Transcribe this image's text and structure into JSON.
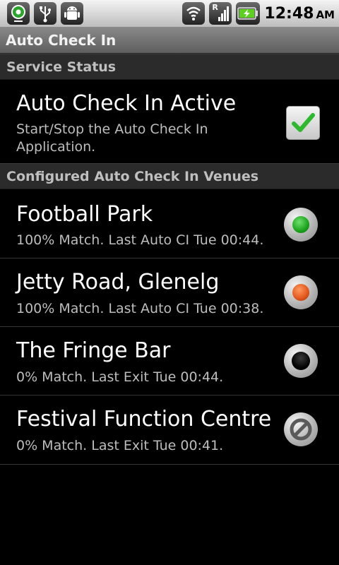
{
  "status_bar": {
    "left_icons": [
      "map-pin-icon",
      "usb-icon",
      "android-debug-icon"
    ],
    "right_icons": [
      "wifi-icon",
      "signal-icon",
      "battery-charging-icon"
    ],
    "signal_label": "R",
    "time": "12:48",
    "ampm": "AM"
  },
  "app": {
    "title": "Auto Check In"
  },
  "sections": {
    "service_status": "Service Status",
    "venues": "Configured Auto Check In Venues"
  },
  "service": {
    "title": "Auto Check In Active",
    "summary_line1": "Start/Stop the Auto Check In",
    "summary_line2": "Application.",
    "checked": true
  },
  "venues": [
    {
      "name": "Football Park",
      "summary": "100% Match. Last Auto CI Tue 00:44.",
      "status": "green",
      "color": "#1aa31a"
    },
    {
      "name": "Jetty Road, Glenelg",
      "summary": "100% Match. Last Auto CI Tue 00:38.",
      "status": "orange",
      "color": "#e0551a"
    },
    {
      "name": "The Fringe Bar",
      "summary": "0% Match. Last Exit Tue 00:44.",
      "status": "off",
      "color": "#111111"
    },
    {
      "name": "Festival Function Centre",
      "summary": "0% Match. Last Exit Tue 00:41.",
      "status": "disabled",
      "color": "#666666"
    }
  ]
}
